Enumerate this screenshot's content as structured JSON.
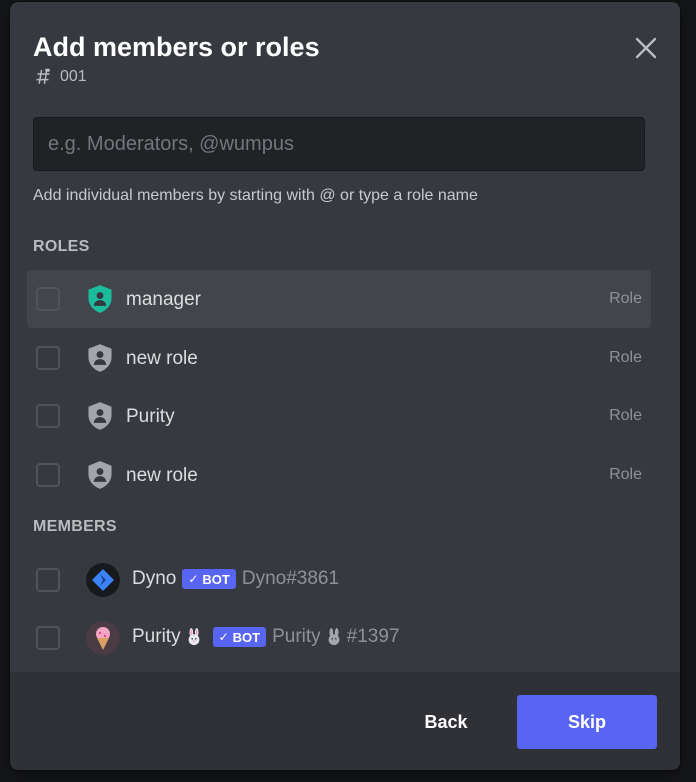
{
  "modal": {
    "title": "Add members or roles",
    "channel_name": "001",
    "close_icon": "close-icon"
  },
  "search": {
    "placeholder": "e.g. Moderators, @wumpus",
    "value": ""
  },
  "hint": "Add individual members by starting with @ or type a role name",
  "roles": {
    "heading": "ROLES",
    "items": [
      {
        "name": "manager",
        "tag": "Role",
        "icon": "shield-person-icon",
        "color": "#1abc9c"
      },
      {
        "name": "new role",
        "tag": "Role",
        "icon": "shield-person-icon",
        "color": "#99aab5"
      },
      {
        "name": "Purity",
        "tag": "Role",
        "icon": "shield-person-icon",
        "color": "#99aab5"
      },
      {
        "name": "new role",
        "tag": "Role",
        "icon": "shield-person-icon",
        "color": "#99aab5"
      }
    ]
  },
  "members": {
    "heading": "MEMBERS",
    "items": [
      {
        "name": "Dyno",
        "badge": "BOT",
        "tag": "Dyno#3861",
        "emoji": ""
      },
      {
        "name": "Purity",
        "badge": "BOT",
        "tag_name": "Purity",
        "tag_discriminator": "#1397",
        "emoji": "rabbit-face"
      }
    ]
  },
  "footer": {
    "back_label": "Back",
    "skip_label": "Skip"
  },
  "colors": {
    "accent": "#5865f2",
    "modal_bg": "#36393f",
    "footer_bg": "#2f3136",
    "input_bg": "#202225"
  }
}
